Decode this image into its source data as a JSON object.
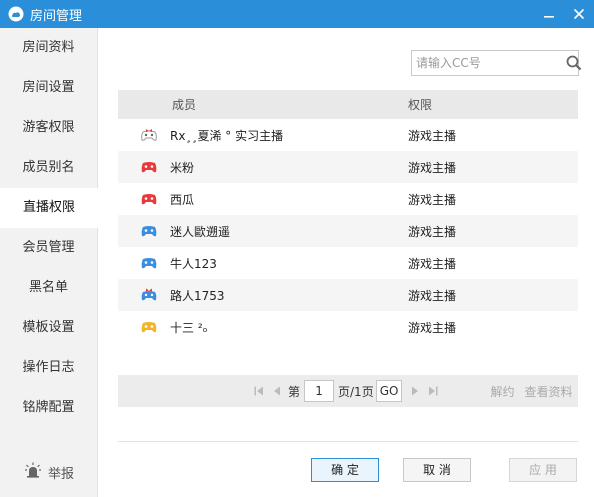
{
  "window": {
    "title": "房间管理",
    "logo_icon": "cc-cloud-icon",
    "accent_color": "#2a8fd8"
  },
  "sidebar": {
    "items": [
      {
        "label": "房间资料"
      },
      {
        "label": "房间设置"
      },
      {
        "label": "游客权限"
      },
      {
        "label": "成员别名"
      },
      {
        "label": "直播权限",
        "active": true
      },
      {
        "label": "会员管理"
      },
      {
        "label": "黑名单"
      },
      {
        "label": "模板设置"
      },
      {
        "label": "操作日志"
      },
      {
        "label": "铭牌配置"
      }
    ],
    "report_label": "举报"
  },
  "search": {
    "placeholder": "请输入CC号",
    "value": ""
  },
  "table": {
    "headers": {
      "member": "成员",
      "permission": "权限"
    },
    "rows": [
      {
        "name": "Rx¸¸夏浠 °  实习主播",
        "permission": "游戏主播",
        "avatar": "gamepad-icon-bow",
        "avatar_color": "#e83a3a"
      },
      {
        "name": "米粉",
        "permission": "游戏主播",
        "avatar": "gamepad-icon-red",
        "avatar_color": "#e83a3a"
      },
      {
        "name": "西瓜",
        "permission": "游戏主播",
        "avatar": "gamepad-icon-red",
        "avatar_color": "#e83a3a"
      },
      {
        "name": "迷人歐遡遥",
        "permission": "游戏主播",
        "avatar": "gamepad-icon-blue",
        "avatar_color": "#3a8ee0"
      },
      {
        "name": "牛人123",
        "permission": "游戏主播",
        "avatar": "gamepad-icon-blue",
        "avatar_color": "#3a8ee0"
      },
      {
        "name": "路人1753",
        "permission": "游戏主播",
        "avatar": "gamepad-icon-blue-bow",
        "avatar_color": "#3a8ee0"
      },
      {
        "name": "十三 ²ₒ",
        "permission": "游戏主播",
        "avatar": "gamepad-icon-yellow",
        "avatar_color": "#f2b52a"
      }
    ]
  },
  "pager": {
    "page_prefix": "第",
    "current_page": "1",
    "page_suffix": "页/1页",
    "go_label": "GO",
    "unban_label": "解约",
    "view_profile_label": "查看资料"
  },
  "buttons": {
    "ok": "确 定",
    "cancel": "取 消",
    "apply": "应 用"
  }
}
